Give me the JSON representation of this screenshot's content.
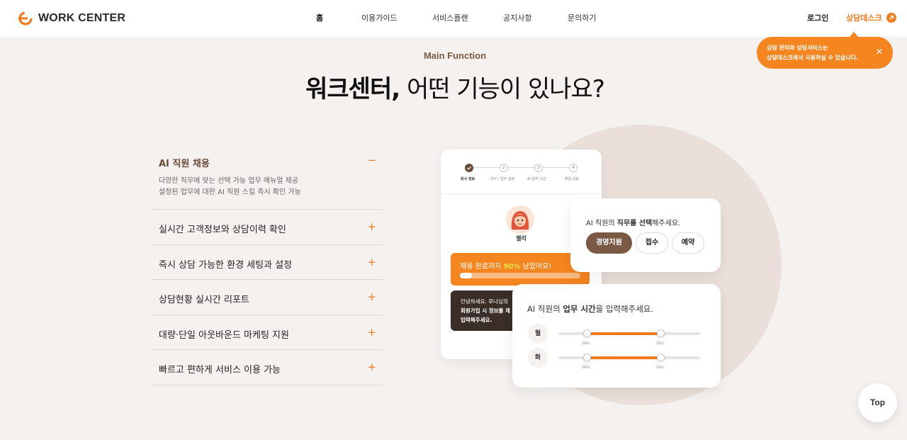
{
  "header": {
    "brand": "WORK CENTER",
    "nav": [
      {
        "label": "홈",
        "active": true
      },
      {
        "label": "이용가이드",
        "active": false
      },
      {
        "label": "서비스플랜",
        "active": false
      },
      {
        "label": "공지사항",
        "active": false
      },
      {
        "label": "문의하기",
        "active": false
      }
    ],
    "login_label": "로그인",
    "desk_label": "상담데스크"
  },
  "tooltip": {
    "line1": "상담 관리와 상담서비스는",
    "line2": "상담데스크에서 사용하실 수 있습니다."
  },
  "section": {
    "eyebrow": "Main Function",
    "title_bold": "워크센터,",
    "title_rest": " 어떤 기능이 있나요?"
  },
  "accordion": [
    {
      "title": "AI 직원 채용",
      "open": true,
      "desc_line1": "다양한 직무에 맞는 선택 가능 업무 매뉴얼 제공",
      "desc_line2": "설정된 업무에 대한 AI 직원 스킬 즉시 확인 가능",
      "sign": "−"
    },
    {
      "title": "실시간 고객정보와 상담이력 확인",
      "open": false,
      "sign": "+"
    },
    {
      "title": "즉시 상담 가능한 환경 세팅과 설정",
      "open": false,
      "sign": "+"
    },
    {
      "title": "상담현황 실시간 리포트",
      "open": false,
      "sign": "+"
    },
    {
      "title": "대량·단일 아웃바운드 마케팅 지원",
      "open": false,
      "sign": "+"
    },
    {
      "title": "빠르고 편하게 서비스 이용 가능",
      "open": false,
      "sign": "+"
    }
  ],
  "phone": {
    "steps": [
      {
        "num": "",
        "label": "회사 정보",
        "done": true
      },
      {
        "num": "2",
        "label": "직무 / 업무 설정",
        "done": false
      },
      {
        "num": "3",
        "label": "AI 업무 시간",
        "done": false
      },
      {
        "num": "4",
        "label": "채용 완료",
        "done": false
      }
    ],
    "avatar_name": "엘리",
    "progress_prefix": "채용 완료까지 ",
    "progress_value": "90%",
    "progress_suffix": " 남았어요!",
    "progress_fraction": 0.1,
    "chat_line1": "안녕하세요. 루나님의",
    "chat_line2": "회원가입 시 정보를 제",
    "chat_line3": "입력해주세요."
  },
  "job_card": {
    "question_prefix": "AI 직원의 ",
    "question_bold": "직무를 선택",
    "question_suffix": "해주세요.",
    "options": [
      "경영지원",
      "접수",
      "예약"
    ],
    "selected": "경영지원"
  },
  "time_card": {
    "question_prefix": "AI 직원의 ",
    "question_bold": "업무 시간",
    "question_suffix": "을 입력해주세요.",
    "days": [
      {
        "day": "월",
        "start_label": "09시",
        "end_label": "18시",
        "start_fraction": 0.2,
        "end_fraction": 0.72
      },
      {
        "day": "화",
        "start_label": "09시",
        "end_label": "18시",
        "start_fraction": 0.2,
        "end_fraction": 0.72
      }
    ]
  },
  "top_button": "Top",
  "colors": {
    "accent": "#f07a1c",
    "brown": "#7b5a45",
    "background": "#f4f1ef"
  }
}
